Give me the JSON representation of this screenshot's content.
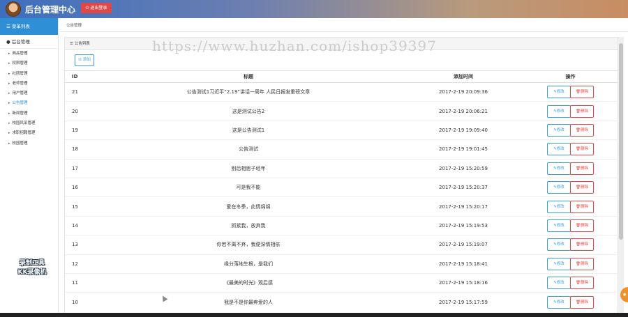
{
  "app": {
    "title": "后台管理中心",
    "logout_label": "退出登录"
  },
  "sidebar": {
    "header": "菜单列表",
    "group": "后台管理",
    "items": [
      {
        "label": "商品管理",
        "active": false
      },
      {
        "label": "权限管理",
        "active": false
      },
      {
        "label": "社团管理",
        "active": false
      },
      {
        "label": "老师管理",
        "active": false
      },
      {
        "label": "用户管理",
        "active": false
      },
      {
        "label": "公告管理",
        "active": true
      },
      {
        "label": "新闻管理",
        "active": false
      },
      {
        "label": "校园风采管理",
        "active": false
      },
      {
        "label": "求职招聘管理",
        "active": false
      },
      {
        "label": "校园管理",
        "active": false
      }
    ],
    "watermark_line1": "录制工具",
    "watermark_line2": "KK录像机"
  },
  "breadcrumb": "公告管理",
  "panel": {
    "title": "公告列表",
    "add_label": "添加"
  },
  "table": {
    "headers": {
      "id": "ID",
      "title": "标题",
      "time": "添加时间",
      "ops": "操作"
    },
    "edit_label": "修改",
    "delete_label": "删除",
    "rows": [
      {
        "id": "21",
        "title": "公告测试1习近平“2.19”讲话一周年 人民日报发重磅文章",
        "time": "2017-2-19 20:09:36"
      },
      {
        "id": "20",
        "title": "这是测试公告2",
        "time": "2017-2-19 20:06:21"
      },
      {
        "id": "19",
        "title": "这是公告测试1",
        "time": "2017-2-19 19:09:40"
      },
      {
        "id": "18",
        "title": "公告测试",
        "time": "2017-2-19 19:01:45"
      },
      {
        "id": "17",
        "title": "别后相思子经年",
        "time": "2017-2-19 15:20:59"
      },
      {
        "id": "16",
        "title": "可是我不能",
        "time": "2017-2-19 15:20:37"
      },
      {
        "id": "15",
        "title": "爱在冬季，此情绵绵",
        "time": "2017-2-19 15:20:17"
      },
      {
        "id": "14",
        "title": "抓紧我，放弃我",
        "time": "2017-2-19 15:19:53"
      },
      {
        "id": "13",
        "title": "你若不离不弃，我便深情相依",
        "time": "2017-2-19 15:19:07"
      },
      {
        "id": "12",
        "title": "缘分落地生根，是我们",
        "time": "2017-2-19 15:18:41"
      },
      {
        "id": "11",
        "title": "《最美的时光》观后感",
        "time": "2017-2-19 15:18:16"
      },
      {
        "id": "10",
        "title": "我是不是你最疼爱的人",
        "time": "2017-2-19 15:17:59"
      }
    ]
  },
  "overlay": {
    "watermark_url": "https://www.huzhan.com/ishop39397"
  }
}
